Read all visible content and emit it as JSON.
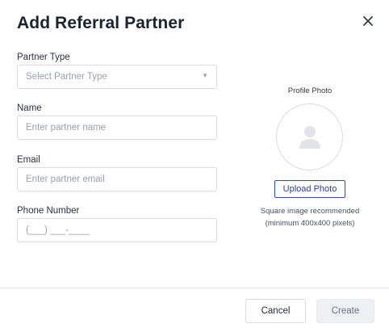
{
  "dialog": {
    "title": "Add Referral Partner",
    "close_icon": "close-icon"
  },
  "form": {
    "partner_type": {
      "label": "Partner Type",
      "placeholder": "Select Partner Type",
      "caret_icon": "chevron-down-icon"
    },
    "name": {
      "label": "Name",
      "placeholder": "Enter partner name",
      "value": ""
    },
    "email": {
      "label": "Email",
      "placeholder": "Enter partner email",
      "value": ""
    },
    "phone": {
      "label": "Phone Number",
      "placeholder": "(___) ___-____",
      "value": ""
    }
  },
  "photo": {
    "label": "Profile Photo",
    "avatar_icon": "user-silhouette-icon",
    "upload_label": "Upload Photo",
    "hint_line1": "Square image recommended",
    "hint_line2": "(minimum 400x400 pixels)"
  },
  "footer": {
    "cancel_label": "Cancel",
    "create_label": "Create"
  },
  "colors": {
    "accent": "#2f4bb0",
    "border": "#d9dde3",
    "placeholder": "#9aa1ab",
    "disabled_bg": "#eef0f3"
  }
}
